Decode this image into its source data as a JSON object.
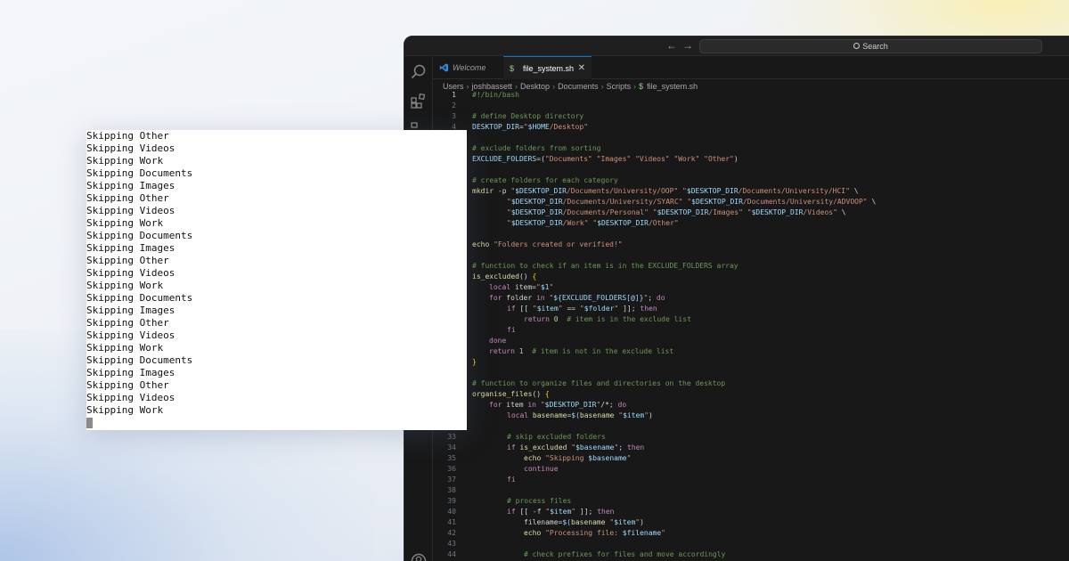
{
  "editor": {
    "search_placeholder": "Search",
    "nav_back": "←",
    "nav_forward": "→",
    "tabs": [
      {
        "label": "Welcome",
        "active": false,
        "icon": "vscode-icon"
      },
      {
        "label": "file_system.sh",
        "active": true,
        "icon": "shell-dollar-icon",
        "close": "✕"
      }
    ],
    "breadcrumb": [
      "Users",
      "joshbassett",
      "Desktop",
      "Documents",
      "Scripts",
      "file_system.sh"
    ],
    "breadcrumb_file_icon": "$",
    "current_line": 1,
    "line_numbers_top": [
      "1",
      "2",
      "3",
      "4"
    ],
    "line_numbers_bottom": [
      "33",
      "34",
      "35",
      "36",
      "37",
      "38",
      "39",
      "40",
      "41",
      "42",
      "43",
      "44"
    ],
    "colors": {
      "editor_bg": "#181818",
      "accent": "#0078d4",
      "comment": "#6a9955",
      "string": "#ce9178",
      "keyword": "#c586c0",
      "variable": "#9cdcfe",
      "function": "#dcdcaa"
    }
  },
  "code_lines": [
    "#!/bin/bash",
    "",
    "# define Desktop directory",
    "DESKTOP_DIR=\"$HOME/Desktop\"",
    "",
    "# exclude folders from sorting",
    "EXCLUDE_FOLDERS=(\"Documents\" \"Images\" \"Videos\" \"Work\" \"Other\")",
    "",
    "# create folders for each category",
    "mkdir -p \"$DESKTOP_DIR/Documents/University/OOP\" \"$DESKTOP_DIR/Documents/University/HCI\" \\",
    "\"$DESKTOP_DIR/Documents/University/SYARC\" \"$DESKTOP_DIR/Documents/University/ADVOOP\" \\",
    "\"$DESKTOP_DIR/Documents/Personal\" \"$DESKTOP_DIR/Images\" \"$DESKTOP_DIR/Videos\" \\",
    "\"$DESKTOP_DIR/Work\" \"$DESKTOP_DIR/Other\"",
    "",
    "echo \"Folders created or verified!\"",
    "",
    "# function to check if an item is in the EXCLUDE_FOLDERS array",
    "is_excluded() {",
    "local item=\"$1\"",
    "for folder in \"${EXCLUDE_FOLDERS[@]}\"; do",
    "if [[ \"$item\" == \"$folder\" ]]; then",
    "return 0  # item is in the exclude list",
    "fi",
    "done",
    "return 1  # item is not in the exclude list",
    "}",
    "",
    "# function to organize files and directories on the desktop",
    "organise_files() {",
    "for item in \"$DESKTOP_DIR\"/*; do",
    "local basename=$(basename \"$item\")",
    "",
    "# skip excluded folders",
    "if is_excluded \"$basename\"; then",
    "echo \"Skipping $basename\"",
    "continue",
    "fi",
    "",
    "# process files",
    "if [[ -f \"$item\" ]]; then",
    "filename=$(basename \"$item\")",
    "echo \"Processing file: $filename\"",
    "",
    "# check prefixes for files and move accordingly"
  ],
  "terminal": {
    "lines": [
      "Skipping Other",
      "Skipping Videos",
      "Skipping Work",
      "Skipping Documents",
      "Skipping Images",
      "Skipping Other",
      "Skipping Videos",
      "Skipping Work",
      "Skipping Documents",
      "Skipping Images",
      "Skipping Other",
      "Skipping Videos",
      "Skipping Work",
      "Skipping Documents",
      "Skipping Images",
      "Skipping Other",
      "Skipping Videos",
      "Skipping Work",
      "Skipping Documents",
      "Skipping Images",
      "Skipping Other",
      "Skipping Videos",
      "Skipping Work"
    ]
  }
}
